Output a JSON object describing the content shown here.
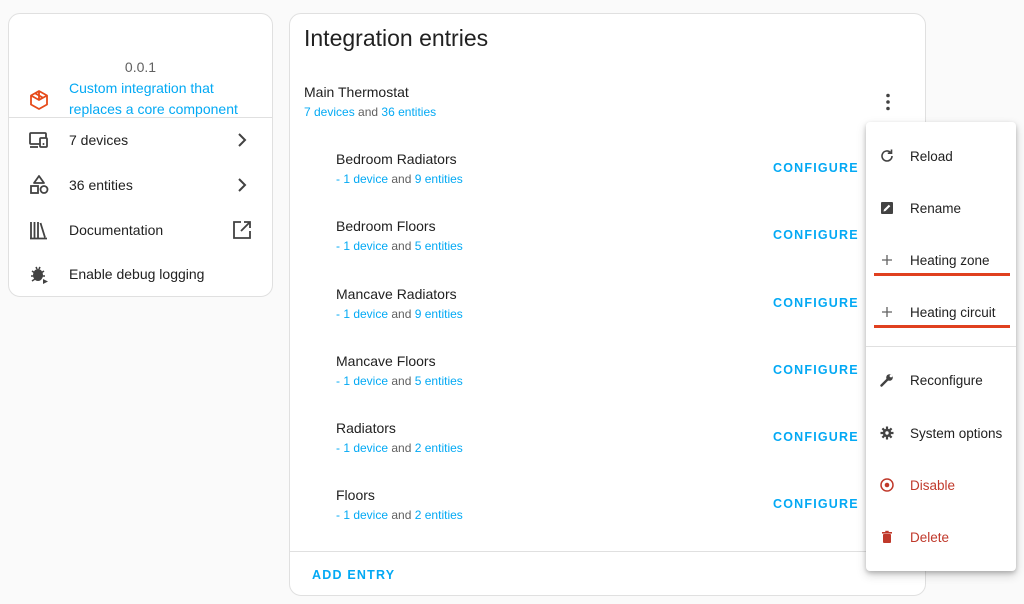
{
  "info": {
    "version": "0.0.1",
    "custom_integration": "Custom integration that replaces a core component",
    "devices": "7 devices",
    "entities": "36 entities",
    "documentation": "Documentation",
    "debug_logging": "Enable debug logging"
  },
  "entries": {
    "title": "Integration entries",
    "main": {
      "name": "Main Thermostat",
      "devices_link": "7 devices",
      "and": "and",
      "entities_link": "36 entities"
    },
    "sub_entries": [
      {
        "name": "Bedroom Radiators",
        "devices_link": "- 1 device",
        "and": "and",
        "entities_link": "9 entities",
        "configure": "CONFIGURE"
      },
      {
        "name": "Bedroom Floors",
        "devices_link": "- 1 device",
        "and": "and",
        "entities_link": "5 entities",
        "configure": "CONFIGURE"
      },
      {
        "name": "Mancave Radiators",
        "devices_link": "- 1 device",
        "and": "and",
        "entities_link": "9 entities",
        "configure": "CONFIGURE"
      },
      {
        "name": "Mancave Floors",
        "devices_link": "- 1 device",
        "and": "and",
        "entities_link": "5 entities",
        "configure": "CONFIGURE"
      },
      {
        "name": "Radiators",
        "devices_link": "- 1 device",
        "and": "and",
        "entities_link": "2 entities",
        "configure": "CONFIGURE"
      },
      {
        "name": "Floors",
        "devices_link": "- 1 device",
        "and": "and",
        "entities_link": "2 entities",
        "configure": "CONFIGURE"
      }
    ],
    "add_entry": "ADD ENTRY"
  },
  "menu": {
    "items": [
      {
        "label": "Reload",
        "icon": "reload-icon"
      },
      {
        "label": "Rename",
        "icon": "rename-icon"
      },
      {
        "label": "Heating zone",
        "icon": "plus-icon"
      },
      {
        "label": "Heating circuit",
        "icon": "plus-icon"
      },
      {
        "label": "Reconfigure",
        "icon": "wrench-icon"
      },
      {
        "label": "System options",
        "icon": "gear-icon"
      },
      {
        "label": "Disable",
        "icon": "disable-icon"
      },
      {
        "label": "Delete",
        "icon": "trash-icon"
      }
    ]
  },
  "colors": {
    "accent": "#03a9f4",
    "danger": "#c0392b",
    "highlight_underline": "#e0401f",
    "custom_icon": "#e64a19"
  }
}
